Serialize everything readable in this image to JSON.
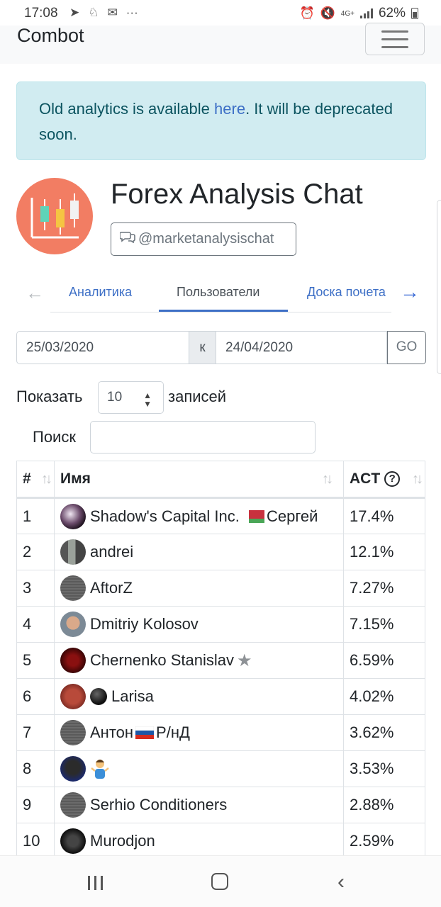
{
  "status_bar": {
    "time": "17:08",
    "battery": "62%",
    "net_label": "4G+"
  },
  "navbar": {
    "brand": "Combot",
    "menu_icon": "hamburger-icon"
  },
  "alert": {
    "prefix": "Old analytics is available ",
    "link": "here",
    "suffix": ". It will be deprecated soon."
  },
  "chat": {
    "title": "Forex Analysis Chat",
    "handle": "@marketanalysischat",
    "handle_icon": "chat-bubbles-icon"
  },
  "tabs": [
    {
      "label": "Аналитика",
      "active": false
    },
    {
      "label": "Пользователи",
      "active": true
    },
    {
      "label": "Доска почета",
      "active": false
    }
  ],
  "date_range": {
    "from": "25/03/2020",
    "separator": "к",
    "to": "24/04/2020",
    "go_label": "GO"
  },
  "table_controls": {
    "show_label": "Показать",
    "page_size": "10",
    "records_label": "записей",
    "search_label": "Поиск",
    "search_value": ""
  },
  "table": {
    "headers": {
      "num": "#",
      "name": "Имя",
      "act": "ACT",
      "help": "?"
    },
    "rows": [
      {
        "num": "1",
        "name": "Shadow's Capital Inc.",
        "name_extra": "Сергей",
        "act": "17.4%"
      },
      {
        "num": "2",
        "name": "andrei",
        "act": "12.1%"
      },
      {
        "num": "3",
        "name": "AftorZ",
        "act": "7.27%"
      },
      {
        "num": "4",
        "name": "Dmitriy Kolosov",
        "act": "7.15%"
      },
      {
        "num": "5",
        "name": "Chernenko Stanislav",
        "act": "6.59%"
      },
      {
        "num": "6",
        "name": "Larisa",
        "act": "4.02%"
      },
      {
        "num": "7",
        "name": "Антон",
        "name_extra": "Р/нД",
        "act": "3.62%"
      },
      {
        "num": "8",
        "name": "",
        "act": "3.53%"
      },
      {
        "num": "9",
        "name": "Serhio Conditioners",
        "act": "2.88%"
      },
      {
        "num": "10",
        "name": "Murodjon",
        "act": "2.59%"
      }
    ]
  },
  "colors": {
    "link": "#3d6fc6",
    "alert_bg": "#d1ecf1",
    "alert_text": "#0c5460",
    "logo_bg": "#f27d63"
  }
}
